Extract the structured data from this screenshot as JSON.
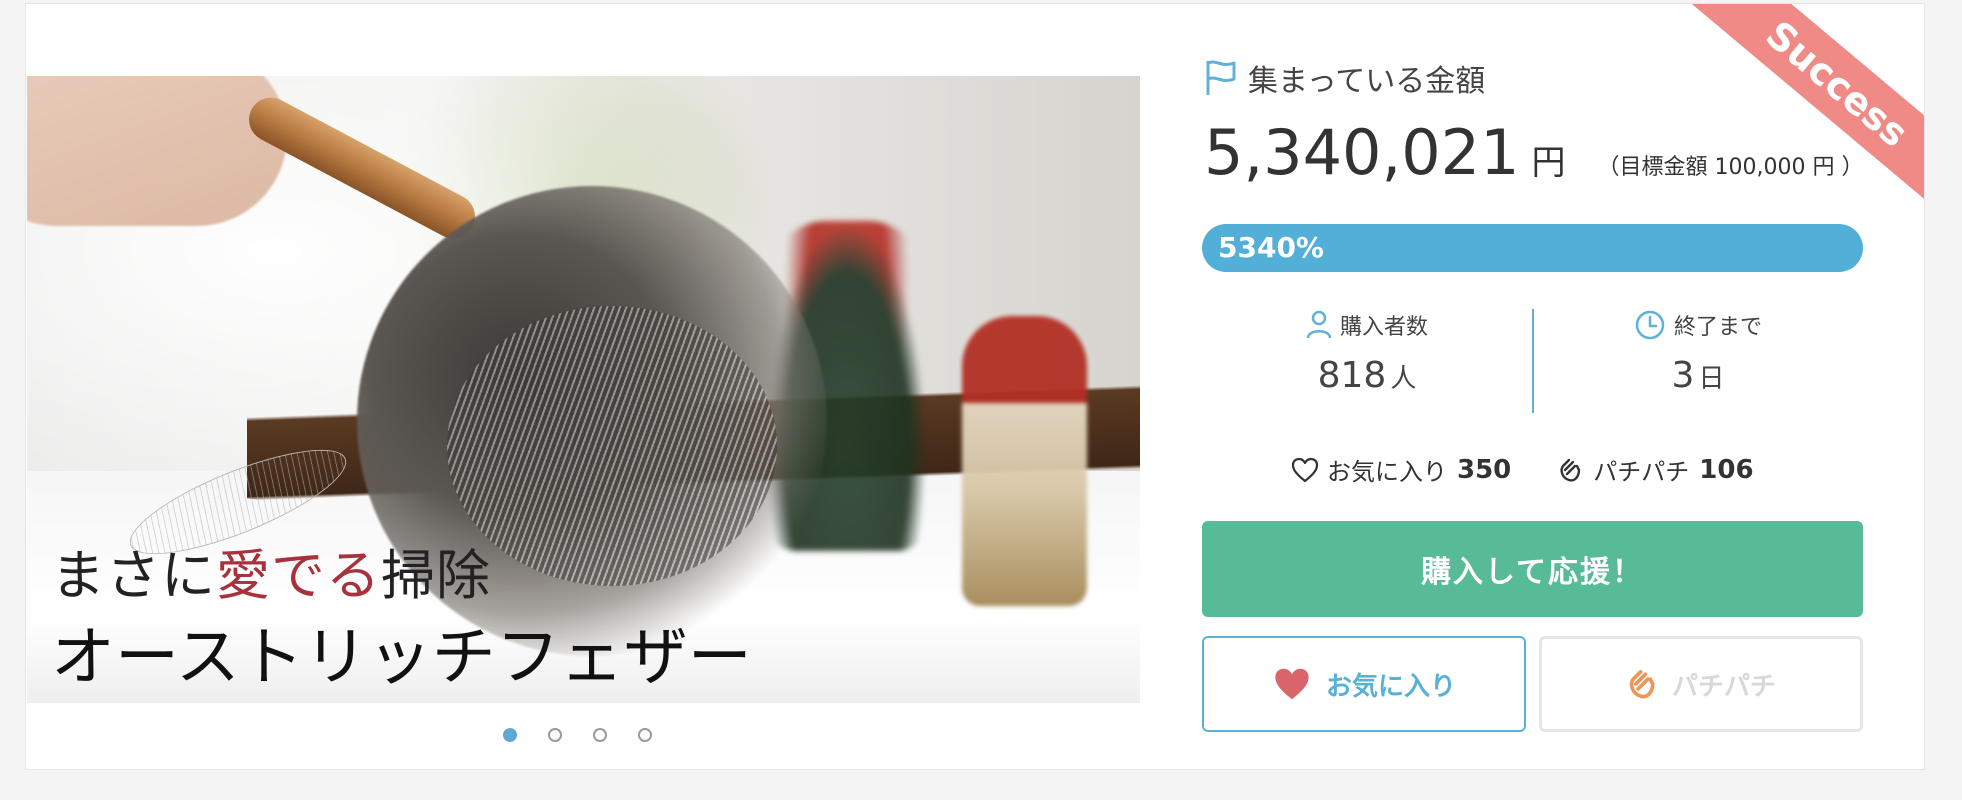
{
  "badge": {
    "label": "Success",
    "color": "#f08a86"
  },
  "hero": {
    "caption_line1_a": "まさに",
    "caption_line1_b": "愛でる",
    "caption_line1_c": "掃除",
    "caption_line2": "オーストリッチフェザー",
    "carousel_count": 4,
    "carousel_active": 1
  },
  "funding": {
    "label": "集まっている金額",
    "amount": "5,340,021",
    "currency": "円",
    "goal": "（目標金額 100,000 円 ）",
    "progress_percent": 5340,
    "progress_label": "5340%",
    "progress_color": "#52b0d8"
  },
  "stats": {
    "buyers_label": "購入者数",
    "buyers_value": "818",
    "buyers_unit": "人",
    "remaining_label": "終了まで",
    "remaining_value": "3",
    "remaining_unit": "日"
  },
  "reactions": {
    "favorites_label": "お気に入り",
    "favorites_count": "350",
    "claps_label": "パチパチ",
    "claps_count": "106"
  },
  "buttons": {
    "buy": "購入して応援！",
    "favorite": "お気に入り",
    "clap": "パチパチ"
  },
  "colors": {
    "accent_blue": "#52b0d8",
    "buy_green": "#58bb98",
    "heart_red": "#d9646a",
    "clap_orange": "#f0955a"
  }
}
